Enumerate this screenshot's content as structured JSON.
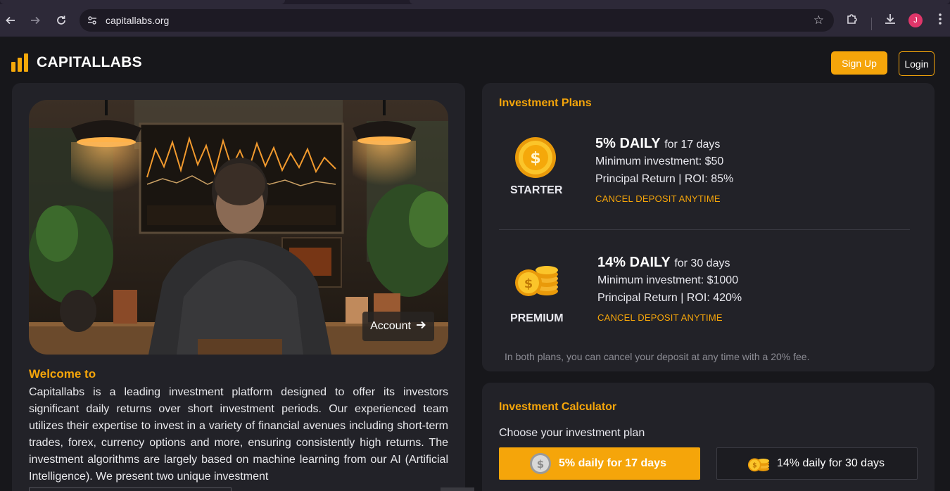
{
  "browser": {
    "url": "capitallabs.org",
    "profile_initial": "J"
  },
  "header": {
    "brand": "CAPITALLABS",
    "signup_label": "Sign Up",
    "login_label": "Login"
  },
  "hero": {
    "account_label": "Account"
  },
  "intro": {
    "heading": "Welcome to",
    "body": "Capitallabs is a leading investment platform designed to offer its investors significant daily returns over short investment periods. Our experienced team utilizes their expertise to invest in a variety of financial avenues including short-term trades, forex, currency options and more, ensuring consistently high returns. The investment algorithms are largely based on machine learning from our AI (Artificial Intelligence). We present two unique investment"
  },
  "plans": {
    "title": "Investment Plans",
    "items": [
      {
        "name": "STARTER",
        "rate": "5% DAILY",
        "duration": "for 17 days",
        "min_investment": "Minimum investment: $50",
        "return": "Principal Return | ROI: 85%",
        "cancel": "CANCEL DEPOSIT ANYTIME"
      },
      {
        "name": "PREMIUM",
        "rate": "14% DAILY",
        "duration": "for 30 days",
        "min_investment": "Minimum investment: $1000",
        "return": "Principal Return | ROI: 420%",
        "cancel": "CANCEL DEPOSIT ANYTIME"
      }
    ],
    "note": "In both plans, you can cancel your deposit at any time with a 20% fee."
  },
  "calculator": {
    "title": "Investment Calculator",
    "prompt": "Choose your investment plan",
    "options": [
      {
        "label": "5% daily for 17 days",
        "selected": true
      },
      {
        "label": "14% daily for 30 days",
        "selected": false
      }
    ]
  },
  "colors": {
    "accent": "#f5a50a",
    "background": "#17171b",
    "card": "#222228"
  }
}
